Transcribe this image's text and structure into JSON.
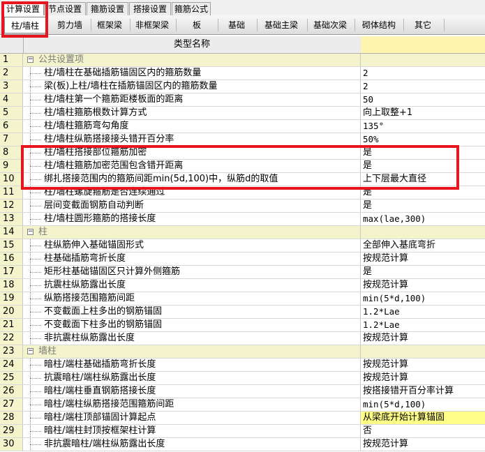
{
  "top_tabs": [
    "计算设置",
    "节点设置",
    "箍筋设置",
    "搭接设置",
    "箍筋公式"
  ],
  "sub_tabs": [
    "柱/墙柱",
    "剪力墙",
    "框架梁",
    "非框架梁",
    "板",
    "基础",
    "基础主梁",
    "基础次梁",
    "砌体结构",
    "其它"
  ],
  "header": {
    "name_col": "类型名称",
    "value_col": ""
  },
  "rows": [
    {
      "n": "1",
      "name": "公共设置项",
      "value": "",
      "group": true
    },
    {
      "n": "2",
      "name": "柱/墙柱在基础插筋锚固区内的箍筋数量",
      "value": "2"
    },
    {
      "n": "3",
      "name": "梁(板)上柱/墙柱在插筋锚固区内的箍筋数量",
      "value": "2"
    },
    {
      "n": "4",
      "name": "柱/墙柱第一个箍筋距楼板面的距离",
      "value": "50"
    },
    {
      "n": "5",
      "name": "柱/墙柱箍筋根数计算方式",
      "value": "向上取整+1"
    },
    {
      "n": "6",
      "name": "柱/墙柱箍筋弯勾角度",
      "value": "135°"
    },
    {
      "n": "7",
      "name": "柱/墙柱纵筋搭接接头错开百分率",
      "value": "50%"
    },
    {
      "n": "8",
      "name": "柱/墙柱搭接部位箍筋加密",
      "value": "是"
    },
    {
      "n": "9",
      "name": "柱/墙柱箍筋加密范围包含错开距离",
      "value": "是"
    },
    {
      "n": "10",
      "name": "绑扎搭接范围内的箍筋间距min(5d,100)中，纵筋d的取值",
      "value": "上下层最大直径"
    },
    {
      "n": "11",
      "name": "柱/墙柱螺旋箍筋是否连续通过",
      "value": "是"
    },
    {
      "n": "12",
      "name": "层间变截面钢筋自动判断",
      "value": "是"
    },
    {
      "n": "13",
      "name": "柱/墙柱圆形箍筋的搭接长度",
      "value": "max(lae,300)"
    },
    {
      "n": "14",
      "name": "柱",
      "value": "",
      "group": true
    },
    {
      "n": "15",
      "name": "柱纵筋伸入基础锚固形式",
      "value": "全部伸入基底弯折"
    },
    {
      "n": "16",
      "name": "柱基础插筋弯折长度",
      "value": "按规范计算"
    },
    {
      "n": "17",
      "name": "矩形柱基础锚固区只计算外侧箍筋",
      "value": "是"
    },
    {
      "n": "18",
      "name": "抗震柱纵筋露出长度",
      "value": "按规范计算"
    },
    {
      "n": "19",
      "name": "纵筋搭接范围箍筋间距",
      "value": "min(5*d,100)"
    },
    {
      "n": "20",
      "name": "不变截面上柱多出的钢筋锚固",
      "value": "1.2*Lae"
    },
    {
      "n": "21",
      "name": "不变截面下柱多出的钢筋锚固",
      "value": "1.2*Lae"
    },
    {
      "n": "22",
      "name": "非抗震柱纵筋露出长度",
      "value": "按规范计算"
    },
    {
      "n": "23",
      "name": "墙柱",
      "value": "",
      "group": true
    },
    {
      "n": "24",
      "name": "暗柱/端柱基础插筋弯折长度",
      "value": "按规范计算"
    },
    {
      "n": "25",
      "name": "抗震暗柱/端柱纵筋露出长度",
      "value": "按规范计算"
    },
    {
      "n": "26",
      "name": "暗柱/端柱垂直钢筋搭接长度",
      "value": "按搭接错开百分率计算"
    },
    {
      "n": "27",
      "name": "暗柱/端柱纵筋搭接范围箍筋间距",
      "value": "min(5*d,100)"
    },
    {
      "n": "28",
      "name": "暗柱/端柱顶部锚固计算起点",
      "value": "从梁底开始计算锚固",
      "highlight": true
    },
    {
      "n": "29",
      "name": "暗柱/端柱封顶按框架柱计算",
      "value": "否"
    },
    {
      "n": "30",
      "name": "非抗震暗柱/端柱纵筋露出长度",
      "value": "按规范计算"
    }
  ],
  "colors": {
    "group_bg": "#f4f4cc",
    "header_value_bg": "#fff3b0",
    "highlight_bg": "#ffff88",
    "annotation_red": "#e8141e"
  }
}
